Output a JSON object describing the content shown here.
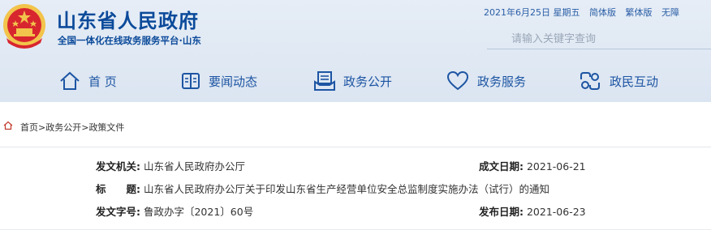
{
  "header": {
    "site_title": "山东省人民政府",
    "site_subtitle": "全国一体化在线政务服务平台·山东",
    "date_text": "2021年6月25日 星期五",
    "links": [
      "简体版",
      "繁体版",
      "无障"
    ],
    "search_placeholder": "请输入关键字查询"
  },
  "nav": [
    {
      "label": "首 页",
      "icon": "home-icon"
    },
    {
      "label": "要闻动态",
      "icon": "book-icon"
    },
    {
      "label": "政务公开",
      "icon": "document-icon"
    },
    {
      "label": "政务服务",
      "icon": "heart-icon"
    },
    {
      "label": "政民互动",
      "icon": "interaction-icon"
    }
  ],
  "breadcrumb": {
    "items": [
      "首页",
      "政务公开",
      "政策文件"
    ],
    "separator": ">"
  },
  "doc": {
    "issuer_label": "发文机关:",
    "issuer": "山东省人民政府办公厅",
    "date_label": "成文日期:",
    "date": "2021-06-21",
    "title_label": "标　　题:",
    "title": "山东省人民政府办公厅关于印发山东省生产经营单位安全总监制度实施办法（试行）的通知",
    "number_label": "发文字号:",
    "number": "鲁政办字〔2021〕60号",
    "pub_label": "发布日期:",
    "pub_date": "2021-06-23"
  },
  "colors": {
    "brand_blue": "#0b4a9a",
    "nav_blue": "#1d55a3",
    "header_bg": "#dfe8f3",
    "emblem_red": "#d8262f",
    "emblem_gold": "#f2c44b"
  }
}
